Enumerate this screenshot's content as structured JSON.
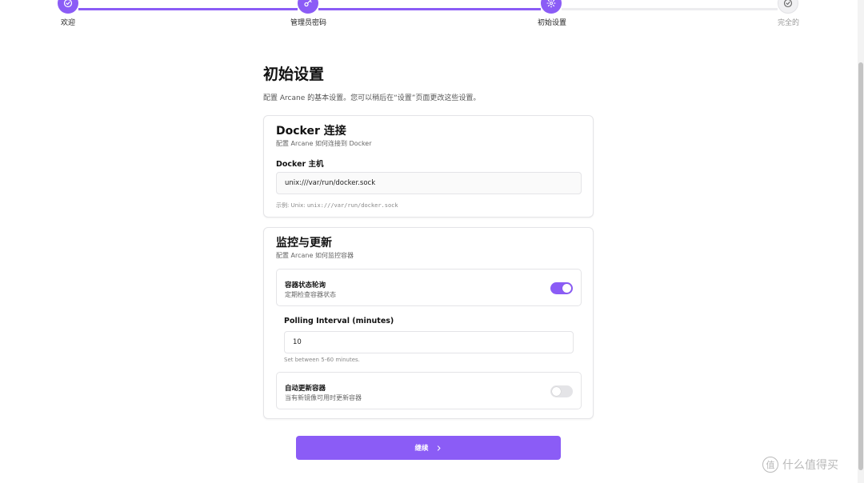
{
  "stepper": {
    "steps": [
      {
        "label": "欢迎",
        "state": "done",
        "icon": "check-circle-icon"
      },
      {
        "label": "管理员密码",
        "state": "done",
        "icon": "key-icon"
      },
      {
        "label": "初始设置",
        "state": "current",
        "icon": "gear-icon"
      },
      {
        "label": "完全的",
        "state": "pending",
        "icon": "check-circle-icon"
      }
    ]
  },
  "page": {
    "title": "初始设置",
    "description": "配置 Arcane 的基本设置。您可以稍后在“设置”页面更改这些设置。"
  },
  "docker_card": {
    "title": "Docker 连接",
    "subtitle": "配置 Arcane 如何连接到 Docker",
    "host_label": "Docker 主机",
    "host_value": "unix:///var/run/docker.sock",
    "hint_prefix": "示例: Unix: ",
    "hint_code": "unix:///var/run/docker.sock"
  },
  "monitor_card": {
    "title": "监控与更新",
    "subtitle": "配置 Arcane 如何监控容器",
    "polling": {
      "title": "容器状态轮询",
      "description": "定期检查容器状态",
      "enabled": true
    },
    "interval_label": "Polling Interval (minutes)",
    "interval_value": "10",
    "interval_hint": "Set between 5-60 minutes.",
    "auto_update": {
      "title": "自动更新容器",
      "description": "当有新镜像可用时更新容器",
      "enabled": false
    }
  },
  "continue_button": {
    "label": "继续",
    "icon": "chevron-right-icon"
  },
  "watermark": {
    "text": "什么值得买",
    "badge": "值"
  },
  "colors": {
    "accent": "#8b5cf6",
    "border": "#e4e4e7"
  }
}
